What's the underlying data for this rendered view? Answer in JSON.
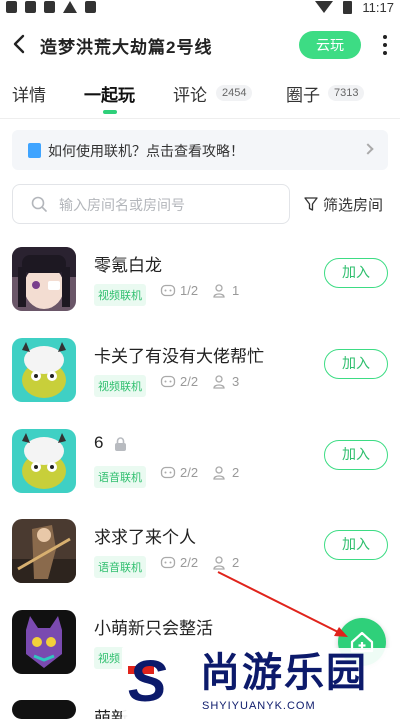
{
  "status_bar": {
    "time": "11:17"
  },
  "header": {
    "title": "造梦洪荒大劫篇2号线",
    "cloud_button": "云玩"
  },
  "tabs": [
    {
      "label": "详情"
    },
    {
      "label": "一起玩",
      "active": true
    },
    {
      "label": "评论",
      "count": "2454"
    },
    {
      "label": "圈子",
      "count": "7313"
    }
  ],
  "tip": {
    "text": "如何使用联机？点击查看攻略！"
  },
  "search": {
    "placeholder": "输入房间名或房间号",
    "value": ""
  },
  "filter": {
    "label": "筛选房间"
  },
  "rooms": [
    {
      "name": "零氪白龙",
      "tag": "视频联机",
      "players": "1/2",
      "viewers": "1",
      "join": "加入",
      "locked": false
    },
    {
      "name": "卡关了有没有大佬帮忙",
      "tag": "视频联机",
      "players": "2/2",
      "viewers": "3",
      "join": "加入",
      "locked": false
    },
    {
      "name": "6",
      "tag": "语音联机",
      "players": "2/2",
      "viewers": "2",
      "join": "加入",
      "locked": true
    },
    {
      "name": "求求了来个人",
      "tag": "语音联机",
      "players": "2/2",
      "viewers": "2",
      "join": "加入",
      "locked": false
    },
    {
      "name": "小萌新只会整活",
      "tag": "视频",
      "players": "",
      "viewers": "",
      "join": "",
      "locked": false
    },
    {
      "name": "萌新",
      "tag": "",
      "players": "",
      "viewers": "",
      "join": "",
      "locked": false
    }
  ],
  "watermark": {
    "logo": "S",
    "title": "尚游乐园",
    "url": "SHYIYUANYK.COM"
  },
  "colors": {
    "accent": "#3ddc84",
    "tag_bg": "#eafaf1",
    "annotation_arrow": "#e0231b",
    "watermark": "#0c1a6b"
  }
}
